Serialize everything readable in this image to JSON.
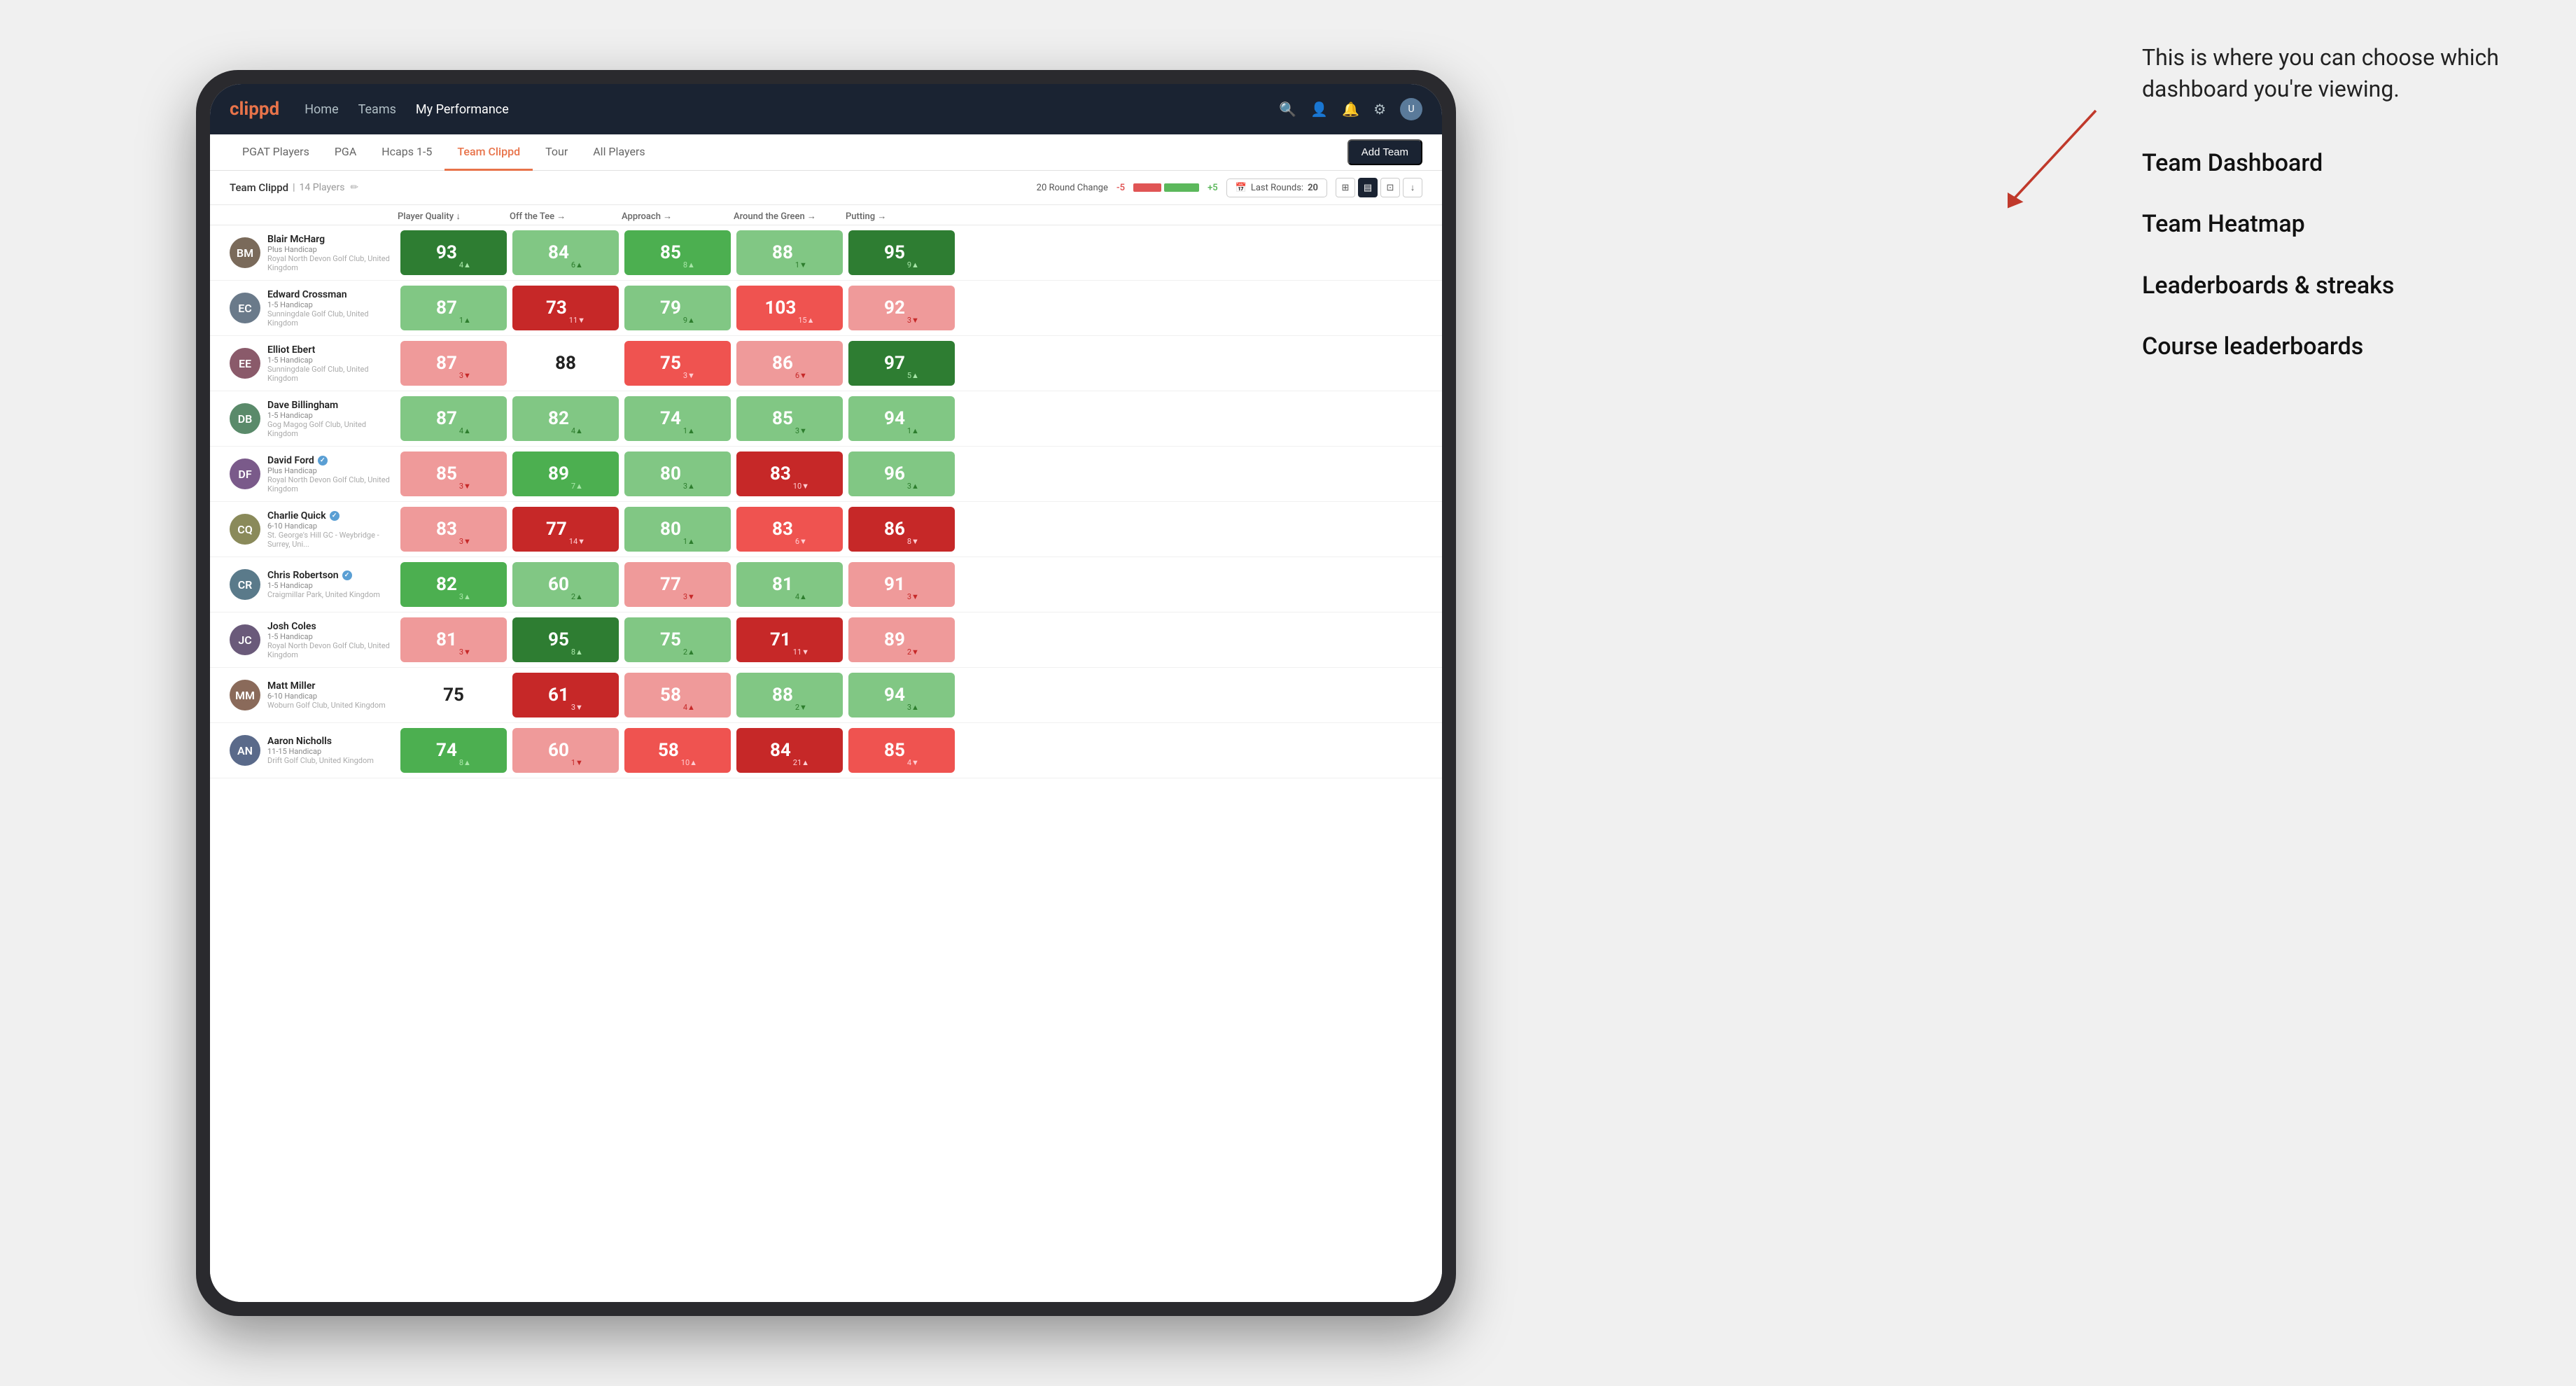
{
  "annotation": {
    "intro": "This is where you can choose which dashboard you're viewing.",
    "items": [
      "Team Dashboard",
      "Team Heatmap",
      "Leaderboards & streaks",
      "Course leaderboards"
    ]
  },
  "nav": {
    "logo": "clippd",
    "links": [
      "Home",
      "Teams",
      "My Performance"
    ],
    "active_link": "My Performance"
  },
  "sub_nav": {
    "links": [
      "PGAT Players",
      "PGA",
      "Hcaps 1-5",
      "Team Clippd",
      "Tour",
      "All Players"
    ],
    "active": "Team Clippd",
    "add_team_label": "Add Team"
  },
  "team_header": {
    "name": "Team Clippd",
    "separator": "|",
    "count_label": "14 Players",
    "round_change_label": "20 Round Change",
    "neg_value": "-5",
    "pos_value": "+5",
    "last_rounds_label": "Last Rounds:",
    "last_rounds_value": "20"
  },
  "table": {
    "columns": [
      "Player Quality ↓",
      "Off the Tee →",
      "Approach →",
      "Around the Green →",
      "Putting →"
    ],
    "players": [
      {
        "name": "Blair McHarg",
        "handicap": "Plus Handicap",
        "club": "Royal North Devon Golf Club, United Kingdom",
        "initials": "BM",
        "scores": [
          {
            "value": "93",
            "change": "4",
            "dir": "up",
            "color": "green-dark"
          },
          {
            "value": "84",
            "change": "6",
            "dir": "up",
            "color": "green-light"
          },
          {
            "value": "85",
            "change": "8",
            "dir": "up",
            "color": "green-medium"
          },
          {
            "value": "88",
            "change": "1",
            "dir": "down",
            "color": "green-light"
          },
          {
            "value": "95",
            "change": "9",
            "dir": "up",
            "color": "green-dark"
          }
        ]
      },
      {
        "name": "Edward Crossman",
        "handicap": "1-5 Handicap",
        "club": "Sunningdale Golf Club, United Kingdom",
        "initials": "EC",
        "scores": [
          {
            "value": "87",
            "change": "1",
            "dir": "up",
            "color": "green-light"
          },
          {
            "value": "73",
            "change": "11",
            "dir": "down",
            "color": "red-dark"
          },
          {
            "value": "79",
            "change": "9",
            "dir": "up",
            "color": "green-light"
          },
          {
            "value": "103",
            "change": "15",
            "dir": "up",
            "color": "red-medium"
          },
          {
            "value": "92",
            "change": "3",
            "dir": "down",
            "color": "red-light"
          }
        ]
      },
      {
        "name": "Elliot Ebert",
        "handicap": "1-5 Handicap",
        "club": "Sunningdale Golf Club, United Kingdom",
        "initials": "EE",
        "scores": [
          {
            "value": "87",
            "change": "3",
            "dir": "down",
            "color": "red-light"
          },
          {
            "value": "88",
            "change": "",
            "dir": "",
            "color": "white"
          },
          {
            "value": "75",
            "change": "3",
            "dir": "down",
            "color": "red-medium"
          },
          {
            "value": "86",
            "change": "6",
            "dir": "down",
            "color": "red-light"
          },
          {
            "value": "97",
            "change": "5",
            "dir": "up",
            "color": "green-dark"
          }
        ]
      },
      {
        "name": "Dave Billingham",
        "handicap": "1-5 Handicap",
        "club": "Gog Magog Golf Club, United Kingdom",
        "initials": "DB",
        "scores": [
          {
            "value": "87",
            "change": "4",
            "dir": "up",
            "color": "green-light"
          },
          {
            "value": "82",
            "change": "4",
            "dir": "up",
            "color": "green-light"
          },
          {
            "value": "74",
            "change": "1",
            "dir": "up",
            "color": "green-light"
          },
          {
            "value": "85",
            "change": "3",
            "dir": "down",
            "color": "green-light"
          },
          {
            "value": "94",
            "change": "1",
            "dir": "up",
            "color": "green-light"
          }
        ]
      },
      {
        "name": "David Ford",
        "handicap": "Plus Handicap",
        "club": "Royal North Devon Golf Club, United Kingdom",
        "initials": "DF",
        "verified": true,
        "scores": [
          {
            "value": "85",
            "change": "3",
            "dir": "down",
            "color": "red-light"
          },
          {
            "value": "89",
            "change": "7",
            "dir": "up",
            "color": "green-medium"
          },
          {
            "value": "80",
            "change": "3",
            "dir": "up",
            "color": "green-light"
          },
          {
            "value": "83",
            "change": "10",
            "dir": "down",
            "color": "red-dark"
          },
          {
            "value": "96",
            "change": "3",
            "dir": "up",
            "color": "green-light"
          }
        ]
      },
      {
        "name": "Charlie Quick",
        "handicap": "6-10 Handicap",
        "club": "St. George's Hill GC - Weybridge - Surrey, Uni...",
        "initials": "CQ",
        "verified": true,
        "scores": [
          {
            "value": "83",
            "change": "3",
            "dir": "down",
            "color": "red-light"
          },
          {
            "value": "77",
            "change": "14",
            "dir": "down",
            "color": "red-dark"
          },
          {
            "value": "80",
            "change": "1",
            "dir": "up",
            "color": "green-light"
          },
          {
            "value": "83",
            "change": "6",
            "dir": "down",
            "color": "red-medium"
          },
          {
            "value": "86",
            "change": "8",
            "dir": "down",
            "color": "red-dark"
          }
        ]
      },
      {
        "name": "Chris Robertson",
        "handicap": "1-5 Handicap",
        "club": "Craigmillar Park, United Kingdom",
        "initials": "CR",
        "verified": true,
        "scores": [
          {
            "value": "82",
            "change": "3",
            "dir": "up",
            "color": "green-medium"
          },
          {
            "value": "60",
            "change": "2",
            "dir": "up",
            "color": "green-light"
          },
          {
            "value": "77",
            "change": "3",
            "dir": "down",
            "color": "red-light"
          },
          {
            "value": "81",
            "change": "4",
            "dir": "up",
            "color": "green-light"
          },
          {
            "value": "91",
            "change": "3",
            "dir": "down",
            "color": "red-light"
          }
        ]
      },
      {
        "name": "Josh Coles",
        "handicap": "1-5 Handicap",
        "club": "Royal North Devon Golf Club, United Kingdom",
        "initials": "JC",
        "scores": [
          {
            "value": "81",
            "change": "3",
            "dir": "down",
            "color": "red-light"
          },
          {
            "value": "95",
            "change": "8",
            "dir": "up",
            "color": "green-dark"
          },
          {
            "value": "75",
            "change": "2",
            "dir": "up",
            "color": "green-light"
          },
          {
            "value": "71",
            "change": "11",
            "dir": "down",
            "color": "red-dark"
          },
          {
            "value": "89",
            "change": "2",
            "dir": "down",
            "color": "red-light"
          }
        ]
      },
      {
        "name": "Matt Miller",
        "handicap": "6-10 Handicap",
        "club": "Woburn Golf Club, United Kingdom",
        "initials": "MM",
        "scores": [
          {
            "value": "75",
            "change": "",
            "dir": "",
            "color": "white"
          },
          {
            "value": "61",
            "change": "3",
            "dir": "down",
            "color": "red-dark"
          },
          {
            "value": "58",
            "change": "4",
            "dir": "up",
            "color": "red-light"
          },
          {
            "value": "88",
            "change": "2",
            "dir": "down",
            "color": "green-light"
          },
          {
            "value": "94",
            "change": "3",
            "dir": "up",
            "color": "green-light"
          }
        ]
      },
      {
        "name": "Aaron Nicholls",
        "handicap": "11-15 Handicap",
        "club": "Drift Golf Club, United Kingdom",
        "initials": "AN",
        "scores": [
          {
            "value": "74",
            "change": "8",
            "dir": "up",
            "color": "green-medium"
          },
          {
            "value": "60",
            "change": "1",
            "dir": "down",
            "color": "red-light"
          },
          {
            "value": "58",
            "change": "10",
            "dir": "up",
            "color": "red-medium"
          },
          {
            "value": "84",
            "change": "21",
            "dir": "up",
            "color": "red-dark"
          },
          {
            "value": "85",
            "change": "4",
            "dir": "down",
            "color": "red-medium"
          }
        ]
      }
    ]
  }
}
